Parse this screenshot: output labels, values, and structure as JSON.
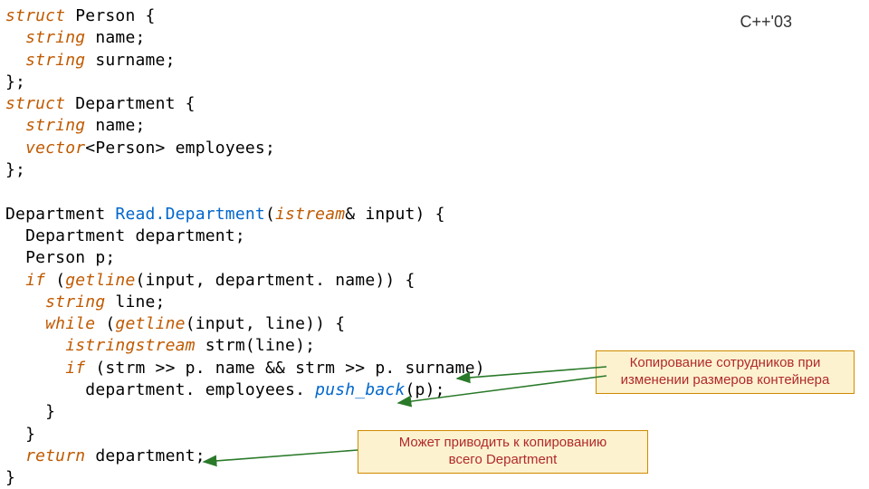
{
  "header": {
    "version_label": "C++'03"
  },
  "code": {
    "l01a": "struct",
    "l01b": " Person {",
    "l02a": "  string",
    "l02b": " name;",
    "l03a": "  string",
    "l03b": " surname;",
    "l04": "};",
    "l05a": "struct",
    "l05b": " Department {",
    "l06a": "  string",
    "l06b": " name;",
    "l07a": "  vector",
    "l07b": "<Person> employees;",
    "l08": "};",
    "l09": "",
    "l10a": "Department ",
    "l10b": "Read.Department",
    "l10c": "(",
    "l10d": "istream",
    "l10e": "& input) {",
    "l11": "  Department department;",
    "l12": "  Person p;",
    "l13a": "  if",
    "l13b": " (",
    "l13c": "getline",
    "l13d": "(input, department. name)) {",
    "l14a": "    string",
    "l14b": " line;",
    "l15a": "    while",
    "l15b": " (",
    "l15c": "getline",
    "l15d": "(input, line)) {",
    "l16a": "      istringstream",
    "l16b": " strm(line);",
    "l17a": "      if",
    "l17b": " (strm >> p. name && strm >> p. surname)",
    "l18a": "        department. employees. ",
    "l18b": "push_back",
    "l18c": "(p);",
    "l19": "    }",
    "l20": "  }",
    "l21a": "  return",
    "l21b": " department;",
    "l22": "}"
  },
  "annotations": {
    "note1": "Копирование сотрудников при изменении размеров контейнера",
    "note2_line1": "Может приводить к копированию",
    "note2_line2": "всего Department"
  }
}
